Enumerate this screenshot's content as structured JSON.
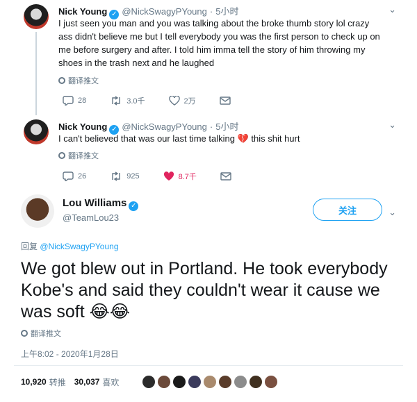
{
  "tweets": [
    {
      "name": "Nick Young",
      "handle": "@NickSwagyPYoung",
      "time": "5小时",
      "text": "I just seen you man and you was talking about the broke thumb story lol crazy ass didn't believe me but I tell everybody you was the first person to check up on me before surgery and after. I told him imma tell the story of him throwing my shoes in the trash next and he laughed",
      "translate": "翻译推文",
      "replies": "28",
      "retweets": "3.0千",
      "likes": "2万"
    },
    {
      "name": "Nick Young",
      "handle": "@NickSwagyPYoung",
      "time": "5小时",
      "text_before": "I can't believed that was our last time talking",
      "text_after": "this shit hurt",
      "translate": "翻译推文",
      "replies": "26",
      "retweets": "925",
      "likes": "8.7千"
    }
  ],
  "main": {
    "name": "Lou Williams",
    "handle": "@TeamLou23",
    "follow_label": "关注",
    "reply_prefix": "回复",
    "reply_handle": "@NickSwagyPYoung",
    "text": "We got blew out in Portland. He took everybody Kobe's and said they couldn't wear it cause we was soft",
    "emoji": "😂😂",
    "translate": "翻译推文",
    "timestamp": "上午8:02 - 2020年1月28日",
    "retweets_count": "10,920",
    "retweets_label": "转推",
    "likes_count": "30,037",
    "likes_label": "喜欢"
  },
  "colors": {
    "accent": "#1da1f2",
    "like_active": "#e0245e",
    "secondary_text": "#657786"
  }
}
